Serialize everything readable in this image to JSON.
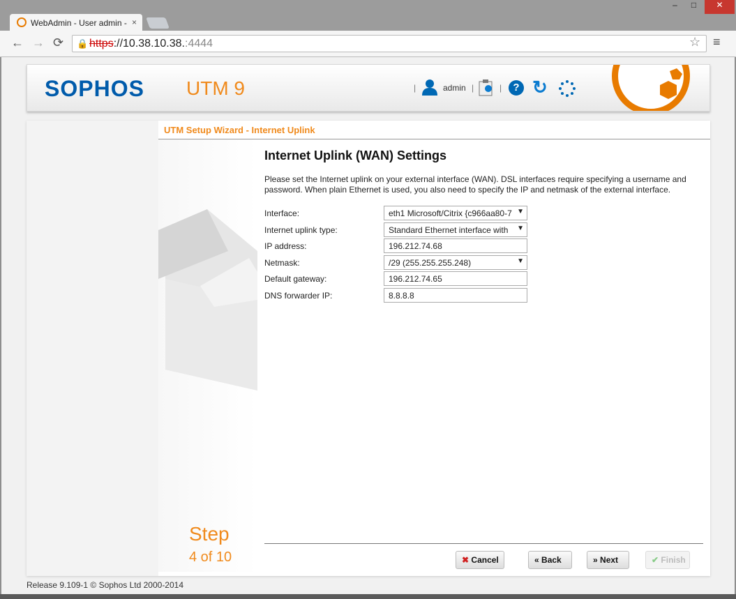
{
  "browser": {
    "tab_title": "WebAdmin - User admin -",
    "tab_close": "×",
    "url_scheme": "https",
    "url_host": "://10.38.10.38.",
    "url_port": ":4444",
    "back": "←",
    "forward": "→",
    "reload": "⟳",
    "star": "☆",
    "menu": "≡",
    "minimize": "–",
    "maximize": "□",
    "close": "✕"
  },
  "header": {
    "logo": "SOPHOS",
    "product": "UTM 9",
    "user": "admin",
    "help": "?",
    "refresh": "↻"
  },
  "wizard": {
    "title": "UTM Setup Wizard - Internet Uplink",
    "step_word": "Step",
    "step_num": "4 of 10",
    "heading": "Internet Uplink (WAN) Settings",
    "description": "Please set the Internet uplink on your external interface (WAN). DSL interfaces require specifying a username and password. When plain Ethernet is used, you also need to specify the IP and netmask of the external interface.",
    "fields": [
      {
        "label": "Interface:",
        "value": "eth1 Microsoft/Citrix {c966aa80-7"
      },
      {
        "label": "Internet uplink type:",
        "value": "Standard Ethernet interface with"
      },
      {
        "label": "IP address:",
        "value": "196.212.74.68"
      },
      {
        "label": "Netmask:",
        "value": "/29 (255.255.255.248)"
      },
      {
        "label": "Default gateway:",
        "value": "196.212.74.65"
      },
      {
        "label": "DNS forwarder IP:",
        "value": "8.8.8.8"
      }
    ],
    "buttons": {
      "cancel": "Cancel",
      "back": "Back",
      "next": "Next",
      "finish": "Finish"
    }
  },
  "footer": "Release 9.109-1  © Sophos Ltd 2000-2014",
  "colors": {
    "accent": "#f08a1c",
    "brand": "#005bab"
  }
}
